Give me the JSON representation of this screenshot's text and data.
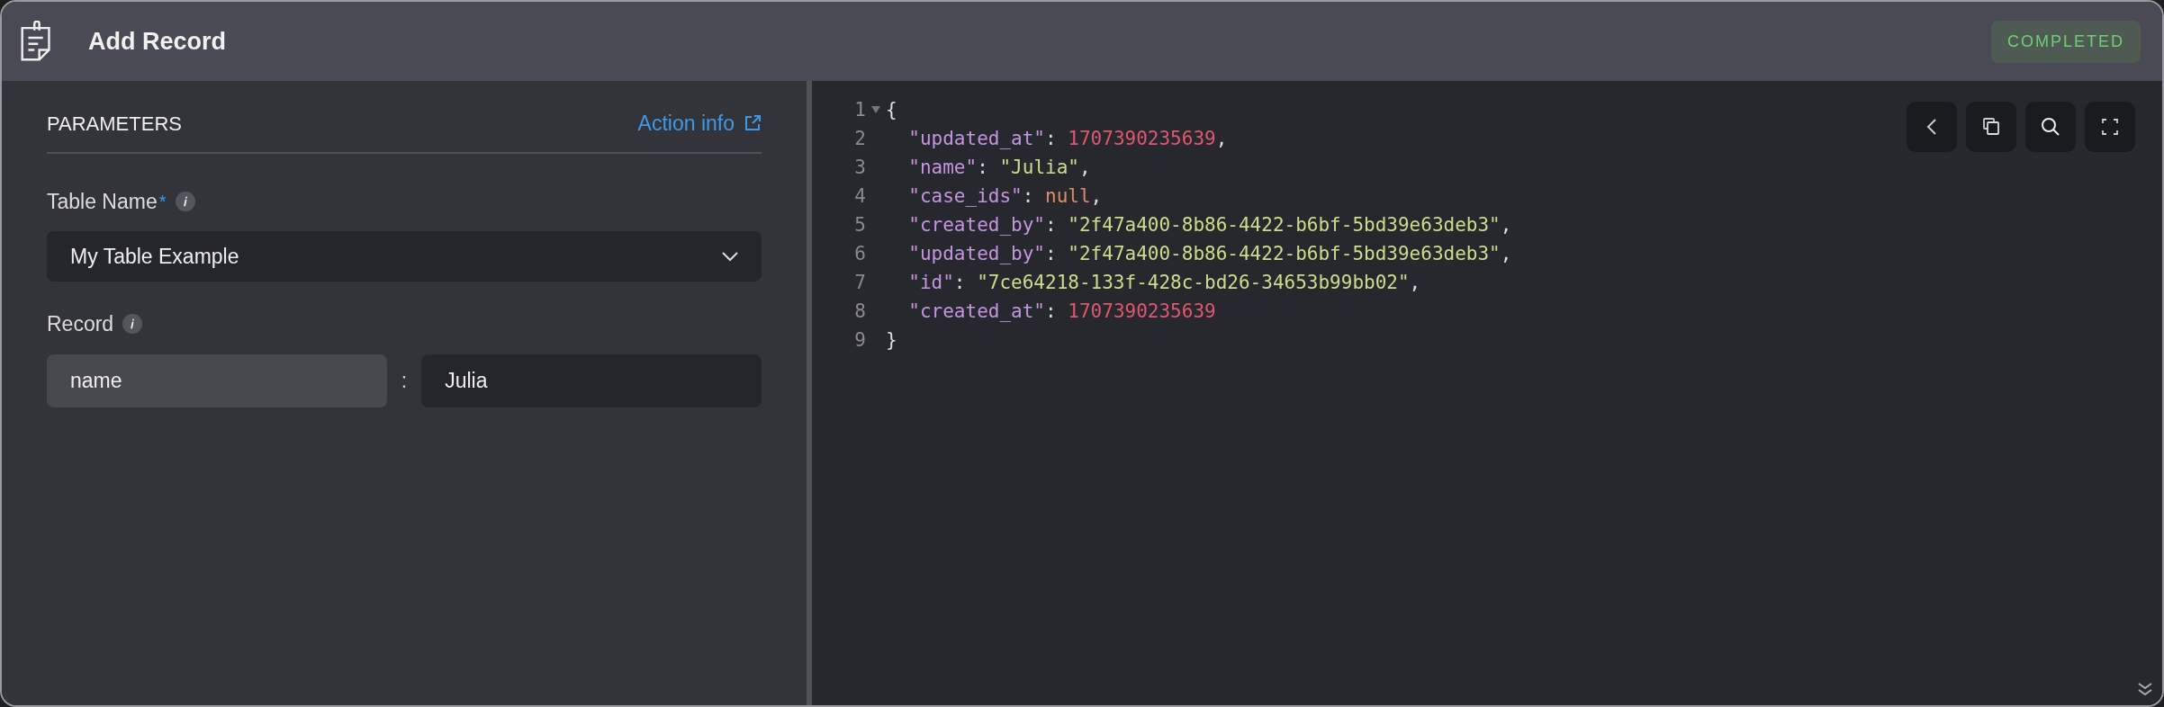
{
  "header": {
    "title": "Add Record",
    "status": "COMPLETED"
  },
  "parameters": {
    "heading": "PARAMETERS",
    "info_link": "Action info",
    "fields": [
      {
        "kind": "select",
        "label": "Table Name",
        "required_mark": "*",
        "value": "My Table Example"
      },
      {
        "kind": "pair",
        "label": "Record",
        "key": "name",
        "separator": ":",
        "value": "Julia"
      }
    ]
  },
  "code": {
    "lines": [
      {
        "number": "1",
        "foldable": true,
        "tokens": [
          {
            "kind": "punct",
            "text": "{"
          }
        ]
      },
      {
        "number": "2",
        "foldable": false,
        "tokens": [
          {
            "kind": "key",
            "text": "  \"updated_at\""
          },
          {
            "kind": "punct",
            "text": ": "
          },
          {
            "kind": "number",
            "text": "1707390235639"
          },
          {
            "kind": "punct",
            "text": ","
          }
        ]
      },
      {
        "number": "3",
        "foldable": false,
        "tokens": [
          {
            "kind": "key",
            "text": "  \"name\""
          },
          {
            "kind": "punct",
            "text": ": "
          },
          {
            "kind": "string",
            "text": "\"Julia\""
          },
          {
            "kind": "punct",
            "text": ","
          }
        ]
      },
      {
        "number": "4",
        "foldable": false,
        "tokens": [
          {
            "kind": "key",
            "text": "  \"case_ids\""
          },
          {
            "kind": "punct",
            "text": ": "
          },
          {
            "kind": "null",
            "text": "null"
          },
          {
            "kind": "punct",
            "text": ","
          }
        ]
      },
      {
        "number": "5",
        "foldable": false,
        "tokens": [
          {
            "kind": "key",
            "text": "  \"created_by\""
          },
          {
            "kind": "punct",
            "text": ": "
          },
          {
            "kind": "string",
            "text": "\"2f47a400-8b86-4422-b6bf-5bd39e63deb3\""
          },
          {
            "kind": "punct",
            "text": ","
          }
        ]
      },
      {
        "number": "6",
        "foldable": false,
        "tokens": [
          {
            "kind": "key",
            "text": "  \"updated_by\""
          },
          {
            "kind": "punct",
            "text": ": "
          },
          {
            "kind": "string",
            "text": "\"2f47a400-8b86-4422-b6bf-5bd39e63deb3\""
          },
          {
            "kind": "punct",
            "text": ","
          }
        ]
      },
      {
        "number": "7",
        "foldable": false,
        "tokens": [
          {
            "kind": "key",
            "text": "  \"id\""
          },
          {
            "kind": "punct",
            "text": ": "
          },
          {
            "kind": "string",
            "text": "\"7ce64218-133f-428c-bd26-34653b99bb02\""
          },
          {
            "kind": "punct",
            "text": ","
          }
        ]
      },
      {
        "number": "8",
        "foldable": false,
        "tokens": [
          {
            "kind": "key",
            "text": "  \"created_at\""
          },
          {
            "kind": "punct",
            "text": ": "
          },
          {
            "kind": "number",
            "text": "1707390235639"
          }
        ]
      },
      {
        "number": "9",
        "foldable": false,
        "tokens": [
          {
            "kind": "punct",
            "text": "}"
          }
        ]
      }
    ],
    "toolbar": [
      {
        "kind": "collapse"
      },
      {
        "kind": "copy"
      },
      {
        "kind": "search"
      },
      {
        "kind": "fullscreen"
      }
    ]
  }
}
